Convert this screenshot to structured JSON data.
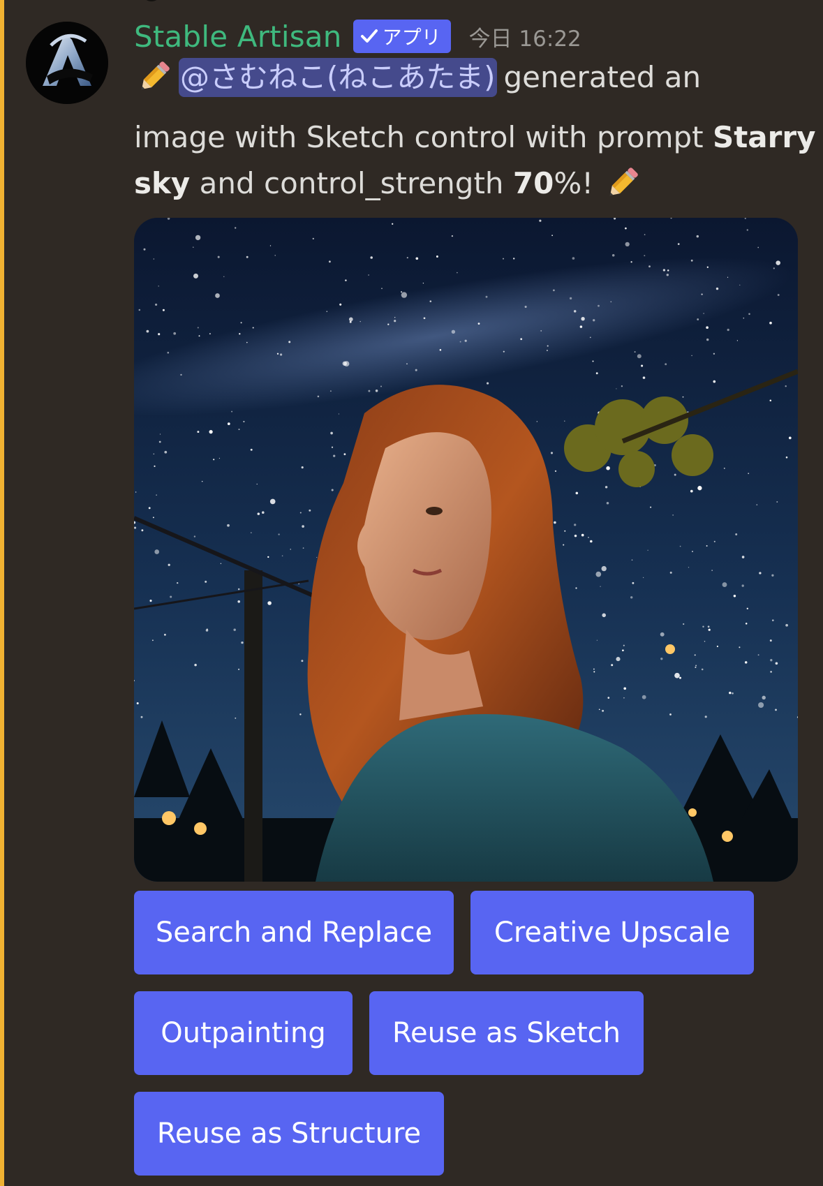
{
  "message": {
    "author": "Stable Artisan",
    "app_badge": "アプリ",
    "timestamp": "今日 16:22",
    "mention": "@さむねこ(ねこあたま)",
    "text_1": "generated an",
    "text_2": "image with Sketch control with prompt",
    "prompt_word_1": "Starry",
    "prompt_word_2": "sky",
    "text_3": "and control_strength",
    "strength_value": "70",
    "text_4": "%!",
    "icons": [
      "pencil-emoji-icon",
      "checkmark-icon",
      "bot-avatar-logo"
    ]
  },
  "buttons": {
    "search_and_replace": "Search and Replace",
    "creative_upscale": "Creative Upscale",
    "outpainting": "Outpainting",
    "reuse_as_sketch": "Reuse as Sketch",
    "reuse_as_structure": "Reuse as Structure"
  },
  "colors": {
    "background": "#2f2924",
    "highlight_bar": "#f0b132",
    "author_name": "#3fb97e",
    "button": "#5865f2",
    "mention_bg": "#454a8c"
  }
}
